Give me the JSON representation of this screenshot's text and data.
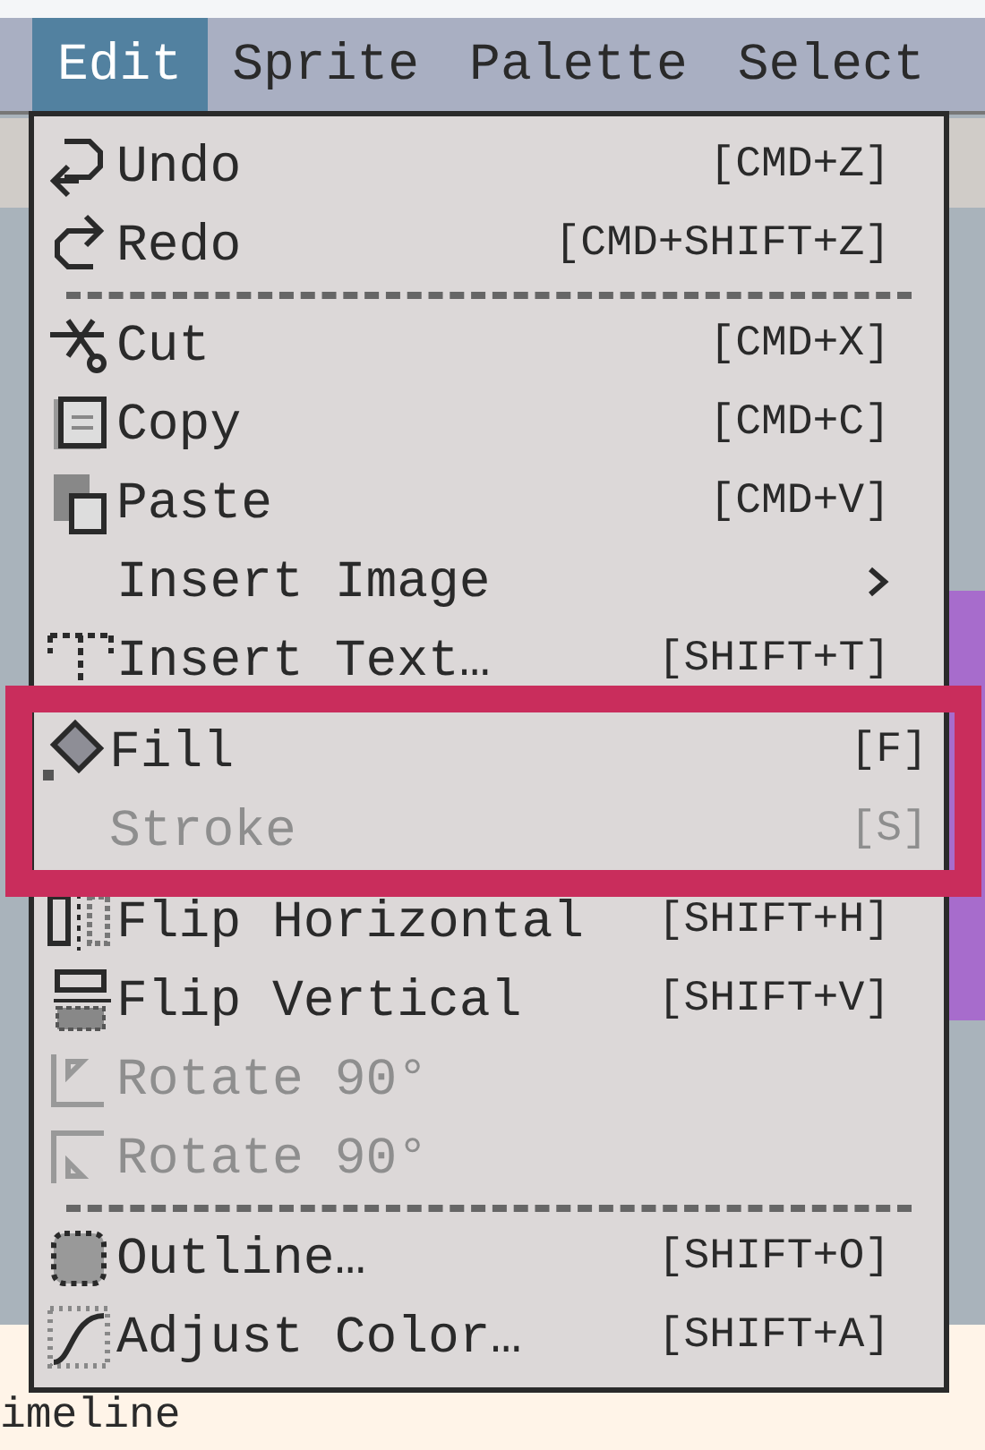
{
  "menubar": [
    {
      "label": "Edit",
      "selected": true
    },
    {
      "label": "Sprite",
      "selected": false
    },
    {
      "label": "Palette",
      "selected": false
    },
    {
      "label": "Select",
      "selected": false
    }
  ],
  "menu": [
    {
      "kind": "item",
      "label": "Undo",
      "shortcut": "[CMD+Z]",
      "disabled": false,
      "highlighted": false
    },
    {
      "kind": "item",
      "label": "Redo",
      "shortcut": "[CMD+SHIFT+Z]",
      "disabled": false,
      "highlighted": false
    },
    {
      "kind": "separator"
    },
    {
      "kind": "item",
      "label": "Cut",
      "shortcut": "[CMD+X]",
      "disabled": false,
      "highlighted": false
    },
    {
      "kind": "item",
      "label": "Copy",
      "shortcut": "[CMD+C]",
      "disabled": false,
      "highlighted": false
    },
    {
      "kind": "item",
      "label": "Paste",
      "shortcut": "[CMD+V]",
      "disabled": false,
      "highlighted": false
    },
    {
      "kind": "submenu",
      "label": "Insert Image",
      "disabled": false,
      "highlighted": false
    },
    {
      "kind": "item",
      "label": "Insert Text…",
      "shortcut": "[SHIFT+T]",
      "disabled": false,
      "highlighted": false
    },
    {
      "kind": "item",
      "label": "Fill",
      "shortcut": "[F]",
      "disabled": false,
      "highlighted": true
    },
    {
      "kind": "item",
      "label": "Stroke",
      "shortcut": "[S]",
      "disabled": true,
      "highlighted": true
    },
    {
      "kind": "item",
      "label": "Flip Horizontal",
      "shortcut": "[SHIFT+H]",
      "disabled": false,
      "highlighted": false
    },
    {
      "kind": "item",
      "label": "Flip Vertical",
      "shortcut": "[SHIFT+V]",
      "disabled": false,
      "highlighted": false
    },
    {
      "kind": "item",
      "label": "Rotate 90°",
      "disabled": true,
      "highlighted": false
    },
    {
      "kind": "item",
      "label": "Rotate 90°",
      "disabled": true,
      "highlighted": false
    },
    {
      "kind": "separator"
    },
    {
      "kind": "item",
      "label": "Outline…",
      "shortcut": "[SHIFT+O]",
      "disabled": false,
      "highlighted": false
    },
    {
      "kind": "item",
      "label": "Adjust Color…",
      "shortcut": "[SHIFT+A]",
      "disabled": false,
      "highlighted": false
    }
  ],
  "timeline_label": "imeline"
}
